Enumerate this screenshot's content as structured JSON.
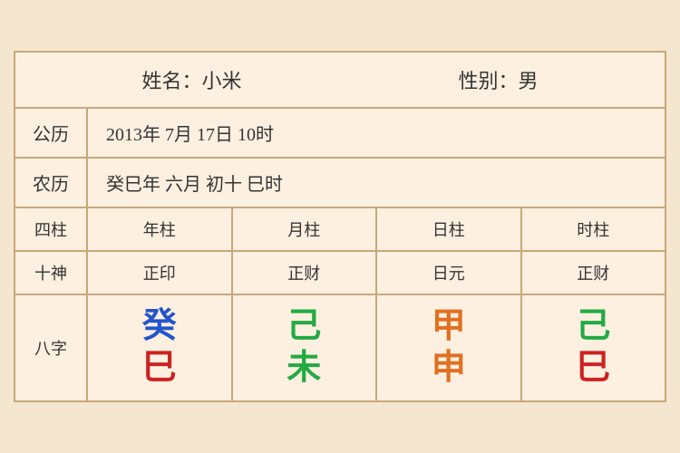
{
  "header": {
    "name_label": "姓名：小米",
    "gender_label": "性别：男"
  },
  "solar": {
    "label": "公历",
    "value": "2013年 7月 17日 10时"
  },
  "lunar": {
    "label": "农历",
    "value": "癸巳年 六月 初十 巳时"
  },
  "sijhu_row": {
    "label": "四柱",
    "cols": [
      "年柱",
      "月柱",
      "日柱",
      "时柱"
    ]
  },
  "shishen_row": {
    "label": "十神",
    "cols": [
      "正印",
      "正财",
      "日元",
      "正财"
    ]
  },
  "bazi_row": {
    "label": "八字",
    "cols": [
      {
        "top": "癸",
        "bottom": "巳",
        "top_color": "blue",
        "bottom_color": "red"
      },
      {
        "top": "己",
        "bottom": "未",
        "top_color": "green",
        "bottom_color": "green"
      },
      {
        "top": "甲",
        "bottom": "申",
        "top_color": "orange",
        "bottom_color": "orange"
      },
      {
        "top": "己",
        "bottom": "巳",
        "top_color": "green",
        "bottom_color": "red"
      }
    ]
  }
}
